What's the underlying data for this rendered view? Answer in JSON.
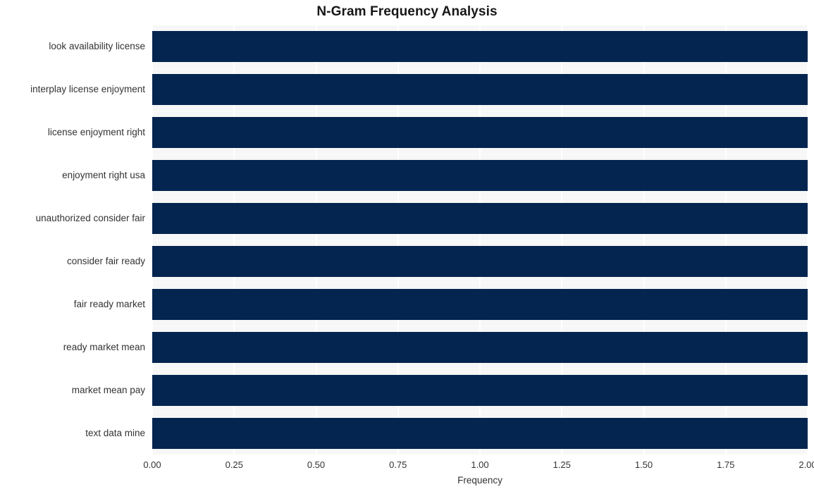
{
  "chart_data": {
    "type": "bar",
    "orientation": "horizontal",
    "title": "N-Gram Frequency Analysis",
    "xlabel": "Frequency",
    "ylabel": "",
    "categories": [
      "look availability license",
      "interplay license enjoyment",
      "license enjoyment right",
      "enjoyment right usa",
      "unauthorized consider fair",
      "consider fair ready",
      "fair ready market",
      "ready market mean",
      "market mean pay",
      "text data mine"
    ],
    "values": [
      2,
      2,
      2,
      2,
      2,
      2,
      2,
      2,
      2,
      2
    ],
    "xlim": [
      0.0,
      2.0
    ],
    "xticks": [
      0.0,
      0.25,
      0.5,
      0.75,
      1.0,
      1.25,
      1.5,
      1.75,
      2.0
    ],
    "xtick_labels": [
      "0.00",
      "0.25",
      "0.50",
      "0.75",
      "1.00",
      "1.25",
      "1.50",
      "1.75",
      "2.00"
    ],
    "grid": true,
    "grid_axis": "x",
    "legend": null,
    "bar_color": "#04254f",
    "plot_background": "#f7f7f7",
    "grid_color": "#ffffff",
    "figure_background": "#ffffff",
    "text_color": "#333333",
    "title_color": "#171717"
  }
}
